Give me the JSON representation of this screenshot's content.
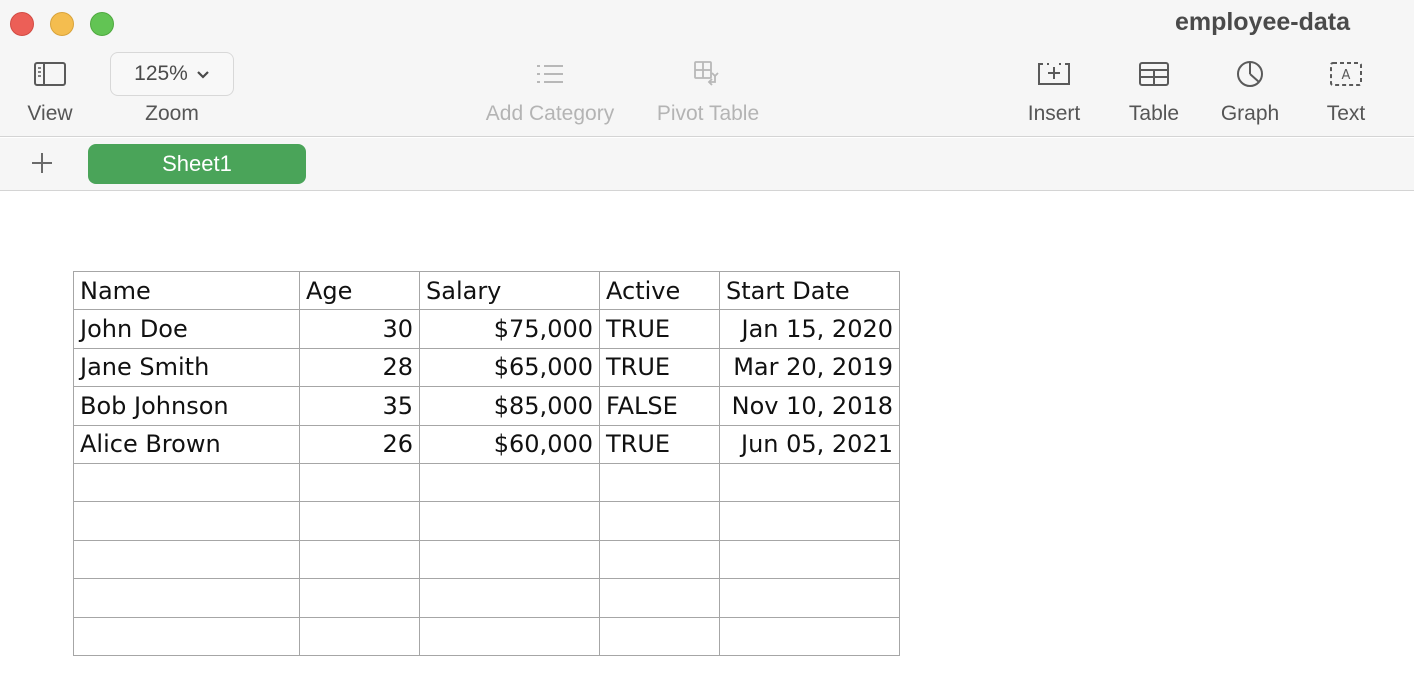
{
  "window": {
    "title": "employee-data"
  },
  "toolbar": {
    "view_label": "View",
    "zoom_value": "125%",
    "zoom_label": "Zoom",
    "add_category_label": "Add Category",
    "pivot_table_label": "Pivot Table",
    "insert_label": "Insert",
    "table_label": "Table",
    "graph_label": "Graph",
    "text_label": "Text",
    "text_icon_glyph": "A"
  },
  "sheets": {
    "tabs": [
      {
        "label": "Sheet1",
        "active": true
      }
    ],
    "active_color": "#4aa459"
  },
  "table": {
    "headers": [
      "Name",
      "Age",
      "Salary",
      "Active",
      "Start Date"
    ],
    "rows": [
      [
        "John Doe",
        "30",
        "$75,000",
        "TRUE",
        "Jan 15, 2020"
      ],
      [
        "Jane Smith",
        "28",
        "$65,000",
        "TRUE",
        "Mar 20, 2019"
      ],
      [
        "Bob Johnson",
        "35",
        "$85,000",
        "FALSE",
        "Nov 10, 2018"
      ],
      [
        "Alice Brown",
        "26",
        "$60,000",
        "TRUE",
        "Jun 05, 2021"
      ],
      [
        "",
        "",
        "",
        "",
        ""
      ],
      [
        "",
        "",
        "",
        "",
        ""
      ],
      [
        "",
        "",
        "",
        "",
        ""
      ],
      [
        "",
        "",
        "",
        "",
        ""
      ],
      [
        "",
        "",
        "",
        "",
        ""
      ]
    ],
    "column_align": [
      "left",
      "right",
      "right",
      "left",
      "right"
    ]
  }
}
